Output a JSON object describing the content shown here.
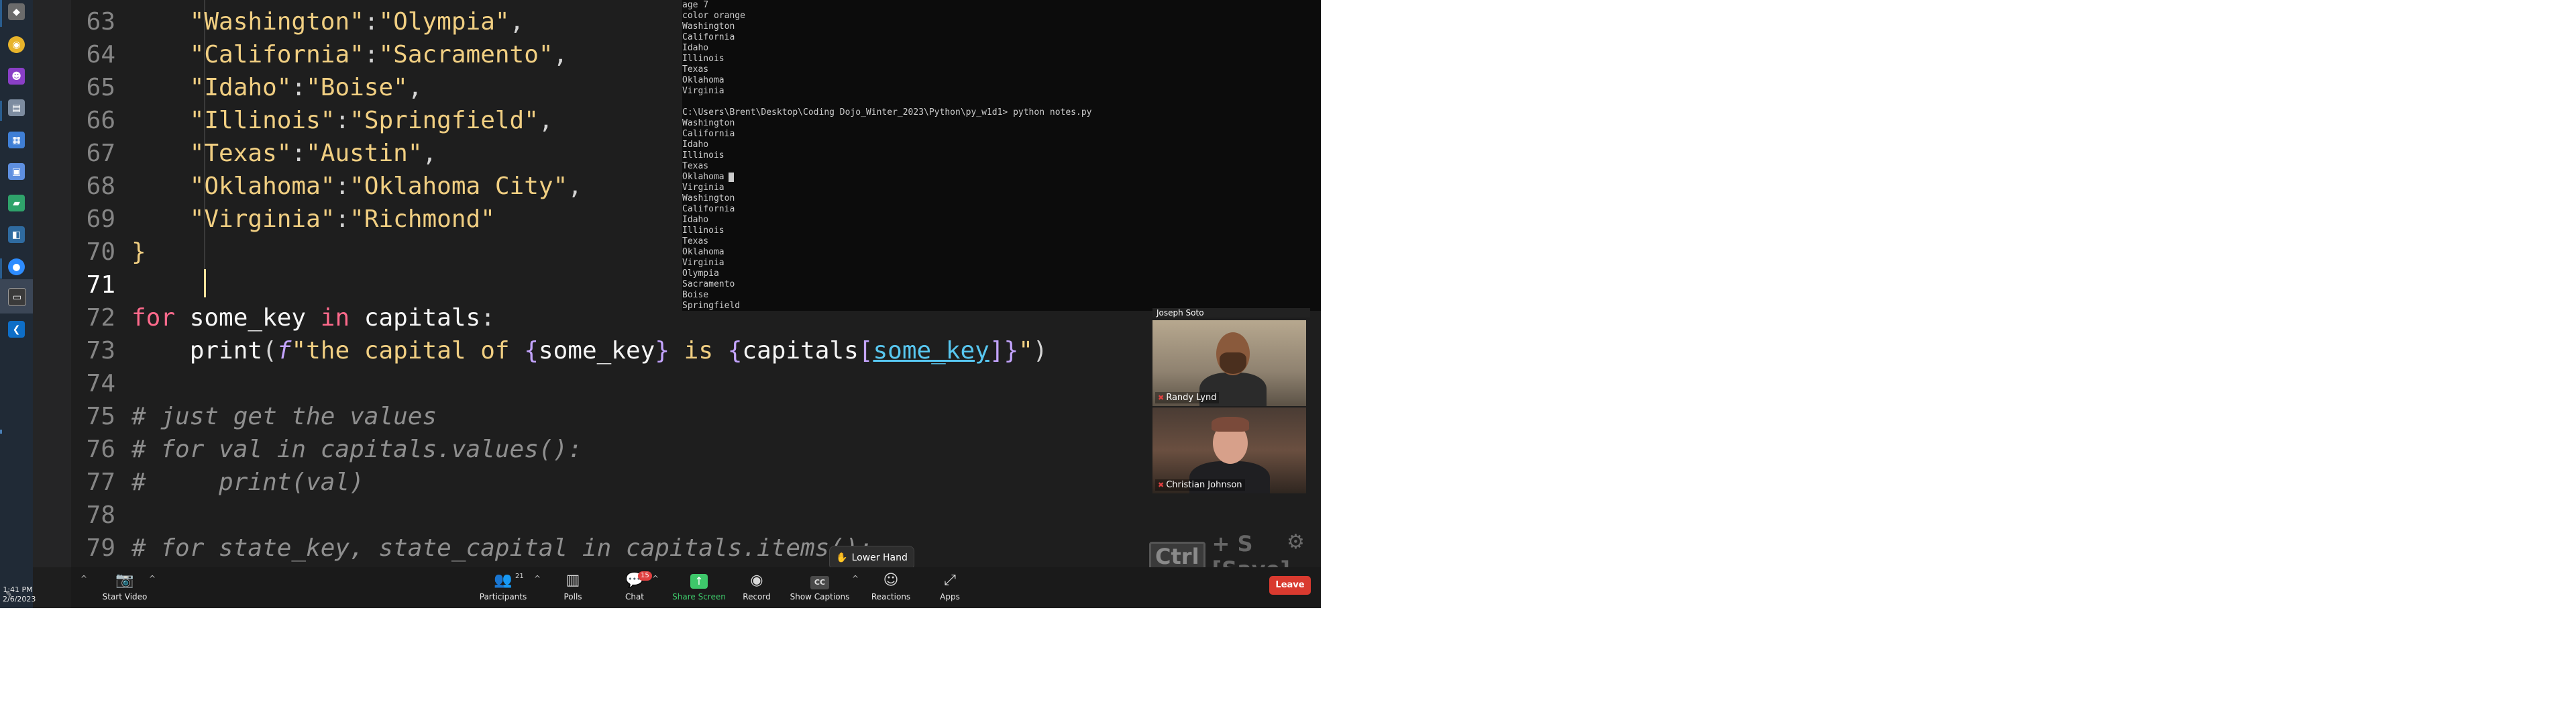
{
  "taskbar": {
    "time": "1:41 PM",
    "date": "2/6/2023"
  },
  "editor": {
    "lines": [
      {
        "num": "63",
        "indent": "    ",
        "tokens": [
          {
            "t": "\"Washington\"",
            "c": "str"
          },
          {
            "t": ":",
            "c": "punct"
          },
          {
            "t": "\"Olympia\"",
            "c": "str"
          },
          {
            "t": ",",
            "c": "punct"
          }
        ]
      },
      {
        "num": "64",
        "indent": "    ",
        "tokens": [
          {
            "t": "\"California\"",
            "c": "str"
          },
          {
            "t": ":",
            "c": "punct"
          },
          {
            "t": "\"Sacramento\"",
            "c": "str"
          },
          {
            "t": ",",
            "c": "punct"
          }
        ]
      },
      {
        "num": "65",
        "indent": "    ",
        "tokens": [
          {
            "t": "\"Idaho\"",
            "c": "str"
          },
          {
            "t": ":",
            "c": "punct"
          },
          {
            "t": "\"Boise\"",
            "c": "str"
          },
          {
            "t": ",",
            "c": "punct"
          }
        ]
      },
      {
        "num": "66",
        "indent": "    ",
        "tokens": [
          {
            "t": "\"Illinois\"",
            "c": "str"
          },
          {
            "t": ":",
            "c": "punct"
          },
          {
            "t": "\"Springfield\"",
            "c": "str"
          },
          {
            "t": ",",
            "c": "punct"
          }
        ]
      },
      {
        "num": "67",
        "indent": "    ",
        "tokens": [
          {
            "t": "\"Texas\"",
            "c": "str"
          },
          {
            "t": ":",
            "c": "punct"
          },
          {
            "t": "\"Austin\"",
            "c": "str"
          },
          {
            "t": ",",
            "c": "punct"
          }
        ]
      },
      {
        "num": "68",
        "indent": "    ",
        "tokens": [
          {
            "t": "\"Oklahoma\"",
            "c": "str"
          },
          {
            "t": ":",
            "c": "punct"
          },
          {
            "t": "\"Oklahoma City\"",
            "c": "str"
          },
          {
            "t": ",",
            "c": "punct"
          }
        ]
      },
      {
        "num": "69",
        "indent": "    ",
        "tokens": [
          {
            "t": "\"Virginia\"",
            "c": "str"
          },
          {
            "t": ":",
            "c": "punct"
          },
          {
            "t": "\"Richmond\"",
            "c": "str"
          }
        ]
      },
      {
        "num": "70",
        "indent": "",
        "tokens": [
          {
            "t": "}",
            "c": "str"
          }
        ]
      },
      {
        "num": "71",
        "indent": "",
        "tokens": []
      },
      {
        "num": "72",
        "indent": "",
        "tokens": [
          {
            "t": "for",
            "c": "key-kw"
          },
          {
            "t": " some_key ",
            "c": "ident"
          },
          {
            "t": "in",
            "c": "key-kw"
          },
          {
            "t": " capitals",
            "c": "ident"
          },
          {
            "t": ":",
            "c": "punct"
          }
        ]
      },
      {
        "num": "73",
        "indent": "    ",
        "tokens": [
          {
            "t": "print",
            "c": "fn"
          },
          {
            "t": "(",
            "c": "punct"
          },
          {
            "t": "f",
            "c": "fprefix"
          },
          {
            "t": "\"the capital of ",
            "c": "str"
          },
          {
            "t": "{",
            "c": "brace"
          },
          {
            "t": "some_key",
            "c": "ident"
          },
          {
            "t": "}",
            "c": "brace"
          },
          {
            "t": " is ",
            "c": "str"
          },
          {
            "t": "{",
            "c": "brace"
          },
          {
            "t": "capitals",
            "c": "ident"
          },
          {
            "t": "[",
            "c": "brace"
          },
          {
            "t": "some_key",
            "c": "hl-var"
          },
          {
            "t": "]",
            "c": "brace"
          },
          {
            "t": "}",
            "c": "brace"
          },
          {
            "t": "\"",
            "c": "str"
          },
          {
            "t": ")",
            "c": "punct"
          }
        ]
      },
      {
        "num": "74",
        "indent": "",
        "tokens": []
      },
      {
        "num": "75",
        "indent": "",
        "tokens": [
          {
            "t": "# just get the values",
            "c": "comment"
          }
        ]
      },
      {
        "num": "76",
        "indent": "",
        "tokens": [
          {
            "t": "# for val in capitals.values():",
            "c": "comment"
          }
        ]
      },
      {
        "num": "77",
        "indent": "",
        "tokens": [
          {
            "t": "#     print(val)",
            "c": "comment"
          }
        ]
      },
      {
        "num": "78",
        "indent": "",
        "tokens": []
      },
      {
        "num": "79",
        "indent": "",
        "tokens": [
          {
            "t": "# for state_key, state_capital in capitals.items():",
            "c": "comment"
          }
        ]
      }
    ],
    "current_line": "71"
  },
  "terminal": {
    "lines": [
      "age 7",
      "color orange",
      "Washington",
      "California",
      "Idaho",
      "Illinois",
      "Texas",
      "Oklahoma",
      "Virginia",
      "",
      "C:\\Users\\Brent\\Desktop\\Coding Dojo_Winter_2023\\Python\\py_w1d1> python notes.py",
      "Washington",
      "California",
      "Idaho",
      "Illinois",
      "Texas",
      "Oklahoma",
      "Virginia",
      "Washington",
      "California",
      "Idaho",
      "Illinois",
      "Texas",
      "Oklahoma",
      "Virginia",
      "Olympia",
      "Sacramento",
      "Boise",
      "Springfield"
    ]
  },
  "participants": {
    "top_label": "Joseph Soto",
    "videos": [
      {
        "name": "Randy Lynd"
      },
      {
        "name": "Christian Johnson"
      }
    ]
  },
  "lower_hand": {
    "label": "Lower Hand"
  },
  "keycast": {
    "key": "Ctrl",
    "rest": "+ S [Save]"
  },
  "zoom_toolbar": {
    "start_video": "Start Video",
    "participants": "Participants",
    "participants_count": "21",
    "polls": "Polls",
    "chat": "Chat",
    "chat_badge": "15",
    "share_screen": "Share Screen",
    "record": "Record",
    "show_captions": "Show Captions",
    "reactions": "Reactions",
    "apps": "Apps",
    "leave": "Leave"
  },
  "colors": {
    "editor_bg": "#1e1e1e",
    "string": "#f1cf82",
    "keyword": "#ff6a8c",
    "comment": "#8f8f8f",
    "leave": "#d93a2f",
    "share_green": "#3ec76a"
  }
}
